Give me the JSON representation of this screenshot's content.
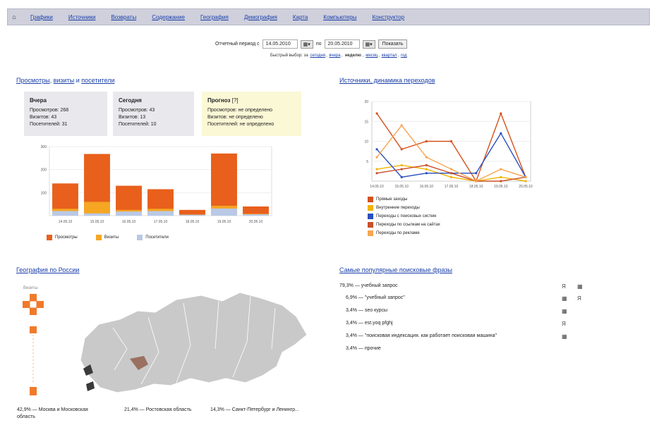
{
  "nav": {
    "home_icon": "home-icon",
    "items": [
      "Графики",
      "Источники",
      "Возвраты",
      "Содержание",
      "География",
      "Демография",
      "Карта",
      "Компьютеры",
      "Конструктор"
    ]
  },
  "period": {
    "label": "Отчетный период с",
    "from": "14.05.2010",
    "to_label": "по",
    "to": "20.05.2010",
    "show_button": "Показать",
    "quick_label": "Быстрый выбор:",
    "quick_prefix": "за",
    "quick_links": [
      "сегодня",
      "вчера"
    ],
    "quick_active": "неделю",
    "quick_links2": [
      "месяц",
      "квартал",
      "год"
    ]
  },
  "traffic": {
    "title_parts": [
      "Просмотры",
      "визиты",
      "посетители"
    ],
    "sep1": ",",
    "sep2": "и",
    "cards": [
      {
        "title": "Вчера",
        "lines": [
          "Просмотров: 268",
          "Визитов: 43",
          "Посетителей: 31"
        ]
      },
      {
        "title": "Сегодня",
        "lines": [
          "Просмотров: 43",
          "Визитов: 13",
          "Посетителей: 10"
        ]
      },
      {
        "title": "Прогноз",
        "lines": [
          "Просмотров: не определено",
          "Визитов: не определено",
          "Посетителей: не определено"
        ]
      }
    ]
  },
  "chart_data": [
    {
      "type": "bar",
      "categories": [
        "14.05.10",
        "15.05.10",
        "16.05.10",
        "17.05.10",
        "18.05.10",
        "19.05.10",
        "20.05.10"
      ],
      "ylim": [
        0,
        300
      ],
      "yticks": [
        100,
        200,
        300
      ],
      "series": [
        {
          "name": "Просмотры",
          "color": "#e8601c",
          "values": [
            140,
            268,
            130,
            115,
            25,
            270,
            40
          ]
        },
        {
          "name": "Визиты",
          "color": "#f5a623",
          "values": [
            30,
            60,
            25,
            30,
            5,
            43,
            8
          ]
        },
        {
          "name": "Посетители",
          "color": "#b9c9e6",
          "values": [
            20,
            10,
            18,
            20,
            4,
            31,
            6
          ]
        }
      ]
    },
    {
      "type": "line",
      "categories": [
        "14.05.10",
        "15.05.10",
        "16.05.10",
        "17.05.10",
        "18.05.10",
        "19.05.10",
        "20.05.10"
      ],
      "ylim": [
        0,
        20
      ],
      "yticks": [
        5,
        10,
        15,
        20
      ],
      "series": [
        {
          "name": "Прямые заходы",
          "color": "#d4521b",
          "values": [
            17,
            8,
            10,
            10,
            0,
            17,
            1
          ]
        },
        {
          "name": "Внутренние переходы",
          "color": "#f0b400",
          "values": [
            3,
            4,
            3,
            1,
            0,
            1,
            0
          ]
        },
        {
          "name": "Переходы с поисковых систем",
          "color": "#2a4fbf",
          "values": [
            8,
            1,
            2,
            2,
            2,
            12,
            1
          ]
        },
        {
          "name": "Переходы по ссылкам на сайтах",
          "color": "#c9502a",
          "values": [
            2,
            3,
            4,
            2,
            0,
            0,
            1
          ]
        },
        {
          "name": "Переходы по рекламе",
          "color": "#f7a552",
          "values": [
            6,
            14,
            6,
            3,
            0,
            3,
            1
          ]
        }
      ]
    }
  ],
  "sources": {
    "title": "Источники, динамика переходов"
  },
  "geo": {
    "title": "География по России",
    "scale_label": "Визиты",
    "regions": [
      {
        "pct": "42,9%",
        "name": "Москва и Московская область"
      },
      {
        "pct": "21,4%",
        "name": "Ростовская область"
      },
      {
        "pct": "14,3%",
        "name": "Санкт-Петербург и Ленингр..."
      }
    ]
  },
  "phrases": {
    "title": "Самые популярные поисковые фразы",
    "items": [
      {
        "pct": "79,3%",
        "text": "учебный запрос"
      },
      {
        "pct": "6,9%",
        "text": "\"учебный запрос\""
      },
      {
        "pct": "3,4%",
        "text": "seo курсы"
      },
      {
        "pct": "3,4%",
        "text": "est.yoq pfghj"
      },
      {
        "pct": "3,4%",
        "text": "\"поисковая индексация. как работает поисковая машина\""
      },
      {
        "pct": "3,4%",
        "text": "прочие"
      }
    ],
    "dash": "—"
  }
}
